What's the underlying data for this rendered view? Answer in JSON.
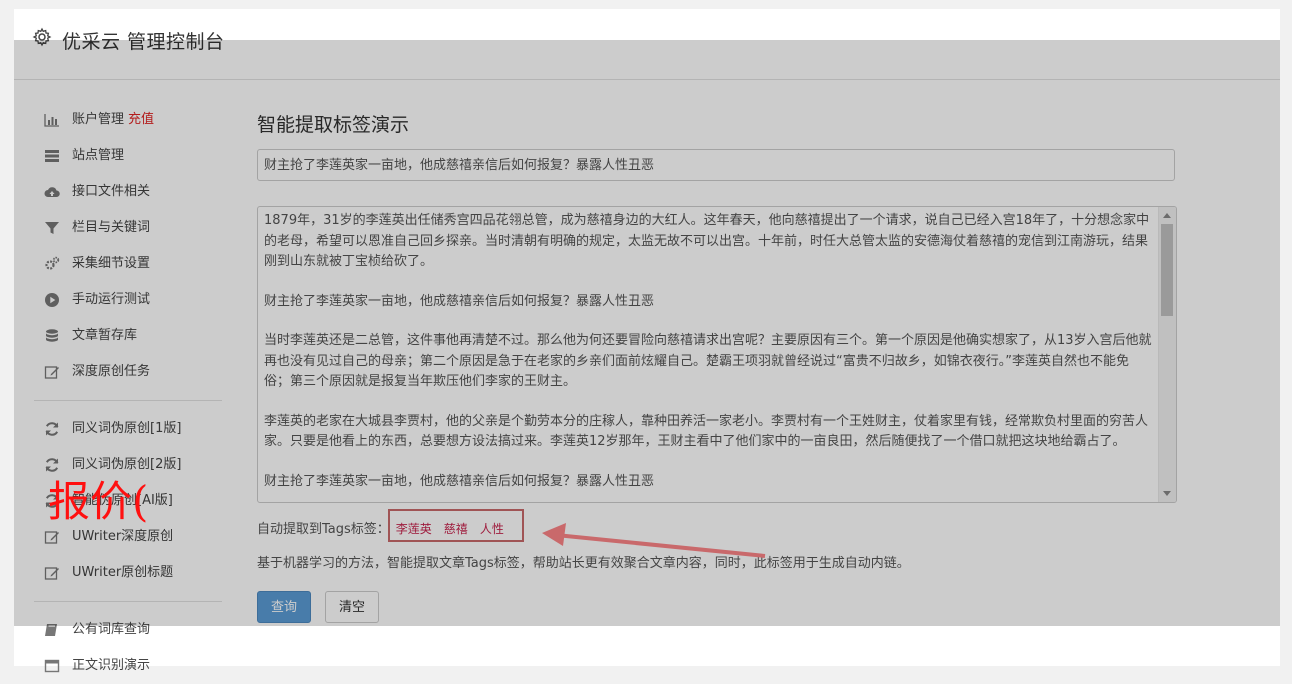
{
  "app": {
    "title": "优采云 管理控制台",
    "icon": "gear-icon"
  },
  "sidebar": {
    "groups": [
      [
        {
          "label": "账户管理",
          "badge": "充值",
          "icon": "bar-chart-icon"
        },
        {
          "label": "站点管理",
          "icon": "list-icon"
        },
        {
          "label": "接口文件相关",
          "icon": "cloud-upload-icon"
        },
        {
          "label": "栏目与关键词",
          "icon": "filter-icon"
        },
        {
          "label": "采集细节设置",
          "icon": "gears-icon"
        },
        {
          "label": "手动运行测试",
          "icon": "play-circle-icon"
        },
        {
          "label": "文章暂存库",
          "icon": "database-icon"
        },
        {
          "label": "深度原创任务",
          "icon": "edit-icon"
        }
      ],
      [
        {
          "label": "同义词伪原创[1版]",
          "icon": "refresh-icon"
        },
        {
          "label": "同义词伪原创[2版]",
          "icon": "refresh-icon"
        },
        {
          "label": "智能伪原创[AI版]",
          "icon": "refresh-icon"
        },
        {
          "label": "UWriter深度原创",
          "icon": "edit-icon"
        },
        {
          "label": "UWriter原创标题",
          "icon": "edit-icon"
        }
      ],
      [
        {
          "label": "公有词库查询",
          "icon": "book-icon"
        },
        {
          "label": "正文识别演示",
          "icon": "window-icon"
        }
      ]
    ]
  },
  "main": {
    "heading": "智能提取标签演示",
    "title_value": "财主抢了李莲英家一亩地，他成慈禧亲信后如何报复？暴露人性丑恶",
    "content_paragraphs": [
      "1879年，31岁的李莲英出任储秀宫四品花翎总管，成为慈禧身边的大红人。这年春天，他向慈禧提出了一个请求，说自己已经入宫18年了，十分想念家中的老母，希望可以恩准自己回乡探亲。当时清朝有明确的规定，太监无故不可以出宫。十年前，时任大总管太监的安德海仗着慈禧的宠信到江南游玩，结果刚到山东就被丁宝桢给砍了。",
      "财主抢了李莲英家一亩地，他成慈禧亲信后如何报复？暴露人性丑恶",
      "当时李莲英还是二总管，这件事他再清楚不过。那么他为何还要冒险向慈禧请求出宫呢？主要原因有三个。第一个原因是他确实想家了，从13岁入宫后他就再也没有见过自己的母亲；第二个原因是急于在老家的乡亲们面前炫耀自己。楚霸王项羽就曾经说过“富贵不归故乡，如锦衣夜行。”李莲英自然也不能免俗；第三个原因就是报复当年欺压他们李家的王财主。",
      "李莲英的老家在大城县李贾村，他的父亲是个勤劳本分的庄稼人，靠种田养活一家老小。李贾村有一个王姓财主，仗着家里有钱，经常欺负村里面的穷苦人家。只要是他看上的东西，总要想方设法搞过来。李莲英12岁那年，王财主看中了他们家中的一亩良田，然后随便找了一个借口就把这块地给霸占了。",
      "财主抢了李莲英家一亩地，他成慈禧亲信后如何报复？暴露人性丑恶"
    ],
    "tags_label": "自动提取到Tags标签：",
    "tags": [
      "李莲英",
      "慈禧",
      "人性"
    ],
    "description": "基于机器学习的方法，智能提取文章Tags标签，帮助站长更有效聚合文章内容，同时，此标签用于生成自动内链。",
    "query_button": "查询",
    "clear_button": "清空"
  },
  "annotation": {
    "text": "报价(",
    "color": "#ff1010",
    "arrow_color": "#c9696b"
  }
}
